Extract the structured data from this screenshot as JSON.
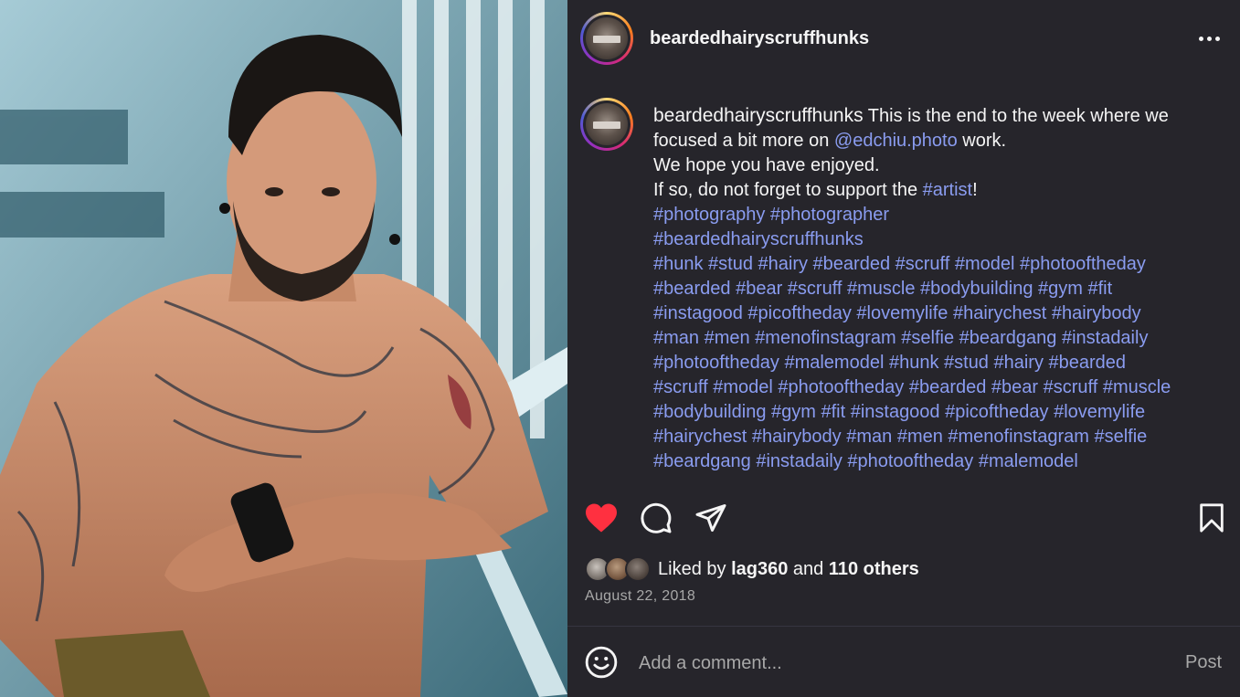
{
  "post": {
    "username": "beardedhairyscruffhunks",
    "photo_alt": "Tattooed shirtless man sitting by a stair railing"
  },
  "caption": {
    "username": "beardedhairyscruffhunks",
    "line1_text": " This is the end to the week where we",
    "line2_pre": "focused a bit more on ",
    "line2_mention": "@edchiu.photo",
    "line2_post": " work.",
    "line3": "We hope you have enjoyed.",
    "line4_pre": "If so, do not forget to support the ",
    "line4_tag": "#artist",
    "line4_post": "!",
    "hashtag_lines": [
      "#photography #photographer",
      "#beardedhairyscruffhunks",
      "#hunk #stud #hairy #bearded #scruff #model #photooftheday",
      "#bearded #bear #scruff #muscle #bodybuilding #gym #fit",
      "#instagood #picoftheday #lovemylife #hairychest #hairybody",
      "#man #men #menofinstagram #selfie #beardgang #instadaily",
      "#photooftheday #malemodel #hunk #stud #hairy #bearded",
      "#scruff #model #photooftheday #bearded #bear #scruff #muscle",
      "#bodybuilding #gym #fit #instagood #picoftheday #lovemylife",
      "#hairychest #hairybody #man #men #menofinstagram #selfie",
      "#beardgang #instadaily #photooftheday #malemodel"
    ]
  },
  "icons": {
    "more": "more-options-icon",
    "like": "heart-icon",
    "comment": "comment-icon",
    "share": "share-icon",
    "save": "bookmark-icon",
    "emoji": "emoji-icon"
  },
  "likes": {
    "prefix": "Liked by ",
    "user": "lag360",
    "middle": " and ",
    "others": "110 others"
  },
  "date": "August 22, 2018",
  "comment_box": {
    "placeholder": "Add a comment...",
    "post_label": "Post"
  },
  "colors": {
    "panel_bg": "#26252b",
    "link": "#8a9cf0",
    "like_red": "#ff3040",
    "muted": "#a8a8a8"
  }
}
